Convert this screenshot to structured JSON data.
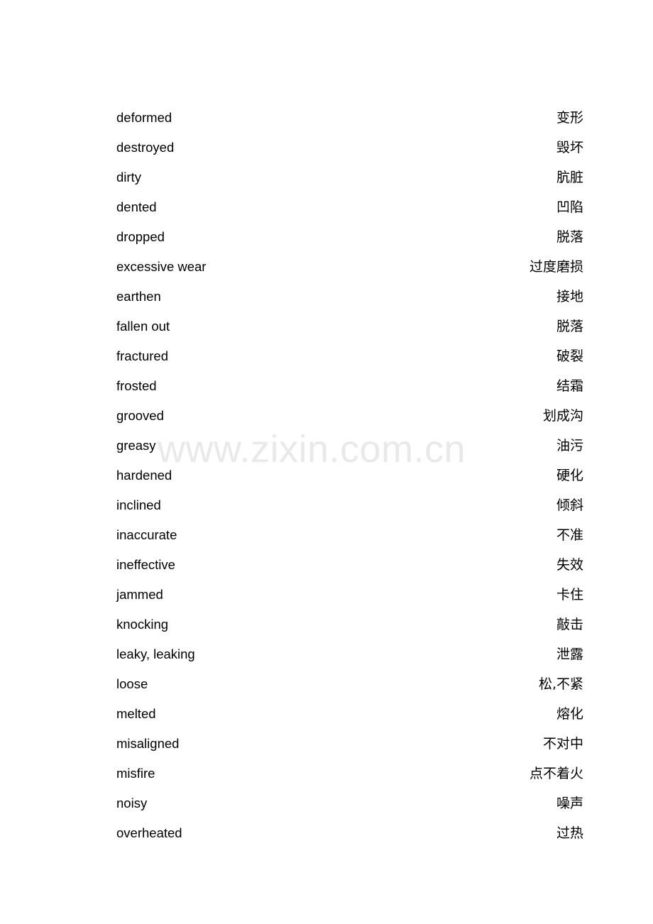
{
  "document": {
    "type": "bilingual-glossary",
    "watermark": "www.zixin.com.cn",
    "watermark_color": "#e9e9e9",
    "text_color": "#000000",
    "background_color": "#ffffff"
  },
  "glossary": {
    "rows": [
      {
        "en": "deformed",
        "zh": "变形"
      },
      {
        "en": "destroyed",
        "zh": "毁坏"
      },
      {
        "en": "dirty",
        "zh": "肮脏"
      },
      {
        "en": "dented",
        "zh": "凹陷"
      },
      {
        "en": "dropped",
        "zh": "脱落"
      },
      {
        "en": "excessive wear",
        "zh": "过度磨损"
      },
      {
        "en": "earthen",
        "zh": "接地"
      },
      {
        "en": "fallen out",
        "zh": "脱落"
      },
      {
        "en": "fractured",
        "zh": "破裂"
      },
      {
        "en": "frosted",
        "zh": "结霜"
      },
      {
        "en": "grooved",
        "zh": "划成沟"
      },
      {
        "en": "greasy",
        "zh": "油污"
      },
      {
        "en": "hardened",
        "zh": "硬化"
      },
      {
        "en": "inclined",
        "zh": "倾斜"
      },
      {
        "en": "inaccurate",
        "zh": "不准"
      },
      {
        "en": "ineffective",
        "zh": "失效"
      },
      {
        "en": "jammed",
        "zh": "卡住"
      },
      {
        "en": "knocking",
        "zh": "敲击"
      },
      {
        "en": "leaky, leaking",
        "zh": "泄露"
      },
      {
        "en": "loose",
        "zh": "松,不紧"
      },
      {
        "en": "melted",
        "zh": "熔化"
      },
      {
        "en": "misaligned",
        "zh": "不对中"
      },
      {
        "en": "misfire",
        "zh": "点不着火"
      },
      {
        "en": "noisy",
        "zh": "噪声"
      },
      {
        "en": "overheated",
        "zh": "过热"
      }
    ]
  }
}
